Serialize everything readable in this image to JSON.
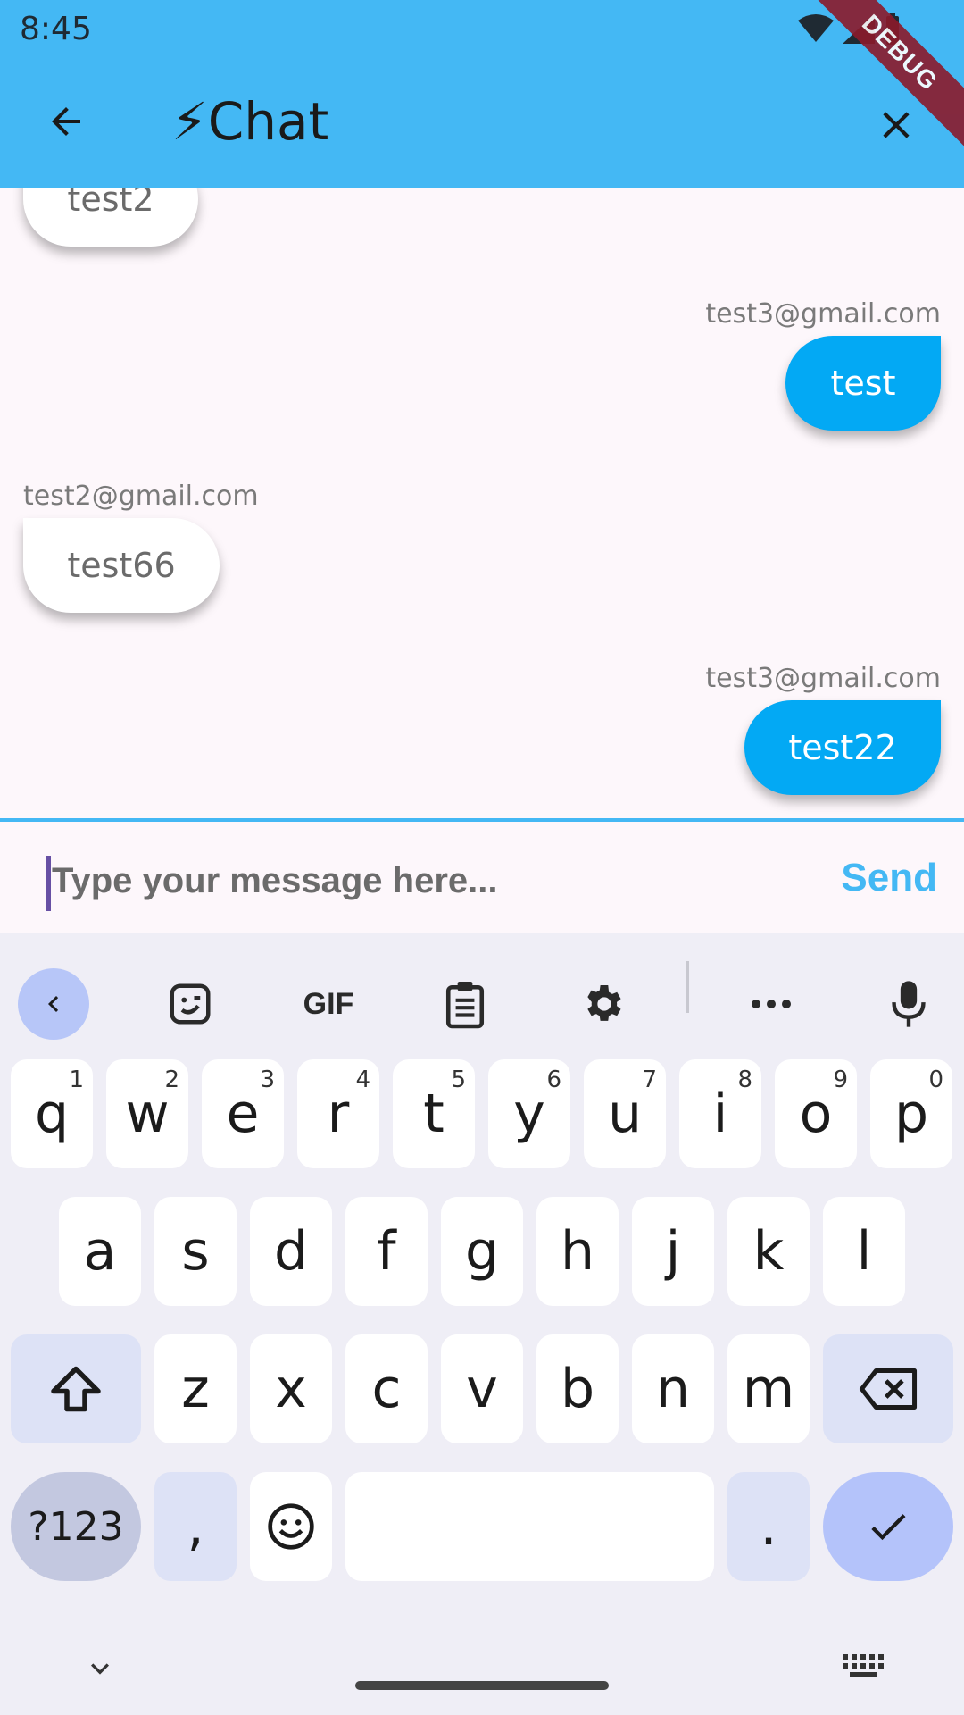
{
  "status_bar": {
    "time": "8:45",
    "icons": [
      "wifi-icon",
      "signal-icon",
      "battery-icon"
    ]
  },
  "app_bar": {
    "title": "⚡Chat",
    "debug_label": "DEBUG",
    "back_icon": "arrow-back-icon",
    "close_icon": "close-icon",
    "color": "#44B8F4"
  },
  "messages": [
    {
      "sender": "",
      "text": "test2",
      "mine": false
    },
    {
      "sender": "test3@gmail.com",
      "text": "test",
      "mine": true
    },
    {
      "sender": "test2@gmail.com",
      "text": "test66",
      "mine": false
    },
    {
      "sender": "test3@gmail.com",
      "text": "test22",
      "mine": true
    }
  ],
  "input": {
    "placeholder": "Type your message here...",
    "send_label": "Send"
  },
  "keyboard": {
    "toolbar": [
      "back-icon",
      "sticker-icon",
      "gif-icon",
      "clipboard-icon",
      "settings-icon",
      "more-icon",
      "mic-icon"
    ],
    "gif_label": "GIF",
    "row1": [
      "q",
      "w",
      "e",
      "r",
      "t",
      "y",
      "u",
      "i",
      "o",
      "p"
    ],
    "row1_hints": [
      "1",
      "2",
      "3",
      "4",
      "5",
      "6",
      "7",
      "8",
      "9",
      "0"
    ],
    "row2": [
      "a",
      "s",
      "d",
      "f",
      "g",
      "h",
      "j",
      "k",
      "l"
    ],
    "row3": [
      "z",
      "x",
      "c",
      "v",
      "b",
      "n",
      "m"
    ],
    "symbols_label": "?123",
    "comma_label": ",",
    "period_label": "."
  }
}
